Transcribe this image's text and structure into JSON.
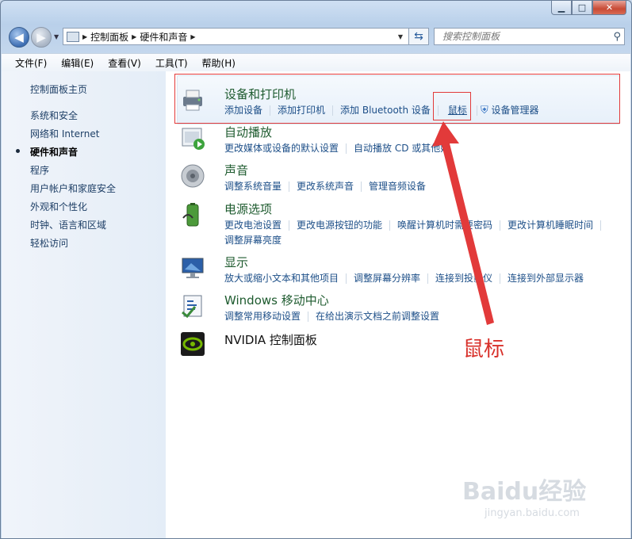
{
  "window": {
    "caption": {
      "minimize": "▁",
      "maximize": "□",
      "close": "✕"
    }
  },
  "address": {
    "crumbs": [
      "控制面板",
      "硬件和声音"
    ],
    "search_placeholder": "搜索控制面板"
  },
  "menu": [
    "文件(F)",
    "编辑(E)",
    "查看(V)",
    "工具(T)",
    "帮助(H)"
  ],
  "sidebar": {
    "items": [
      {
        "label": "控制面板主页",
        "selected": false
      },
      {
        "label": "系统和安全",
        "selected": false
      },
      {
        "label": "网络和 Internet",
        "selected": false
      },
      {
        "label": "硬件和声音",
        "selected": true
      },
      {
        "label": "程序",
        "selected": false
      },
      {
        "label": "用户帐户和家庭安全",
        "selected": false
      },
      {
        "label": "外观和个性化",
        "selected": false
      },
      {
        "label": "时钟、语言和区域",
        "selected": false
      },
      {
        "label": "轻松访问",
        "selected": false
      }
    ]
  },
  "categories": {
    "devices": {
      "title": "设备和打印机",
      "links": [
        "添加设备",
        "添加打印机",
        "添加 Bluetooth 设备",
        "鼠标",
        "设备管理器"
      ]
    },
    "autoplay": {
      "title": "自动播放",
      "links": [
        "更改媒体或设备的默认设置",
        "自动播放 CD 或其他媒"
      ]
    },
    "sound": {
      "title": "声音",
      "links": [
        "调整系统音量",
        "更改系统声音",
        "管理音频设备"
      ]
    },
    "power": {
      "title": "电源选项",
      "links": [
        "更改电池设置",
        "更改电源按钮的功能",
        "唤醒计算机时需要密码",
        "更改计算机睡眠时间",
        "调整屏幕亮度"
      ]
    },
    "display": {
      "title": "显示",
      "links": [
        "放大或缩小文本和其他项目",
        "调整屏幕分辨率",
        "连接到投影仪",
        "连接到外部显示器"
      ]
    },
    "mobility": {
      "title": "Windows 移动中心",
      "links": [
        "调整常用移动设置",
        "在给出演示文档之前调整设置"
      ]
    },
    "nvidia": {
      "title": "NVIDIA 控制面板"
    }
  },
  "annotation": "鼠标",
  "watermark": {
    "logo": "Baidu经验",
    "url": "jingyan.baidu.com"
  },
  "colors": {
    "annotation_red": "#d8302a",
    "link_blue": "#1d4f88",
    "title_green": "#1e5b2f"
  }
}
